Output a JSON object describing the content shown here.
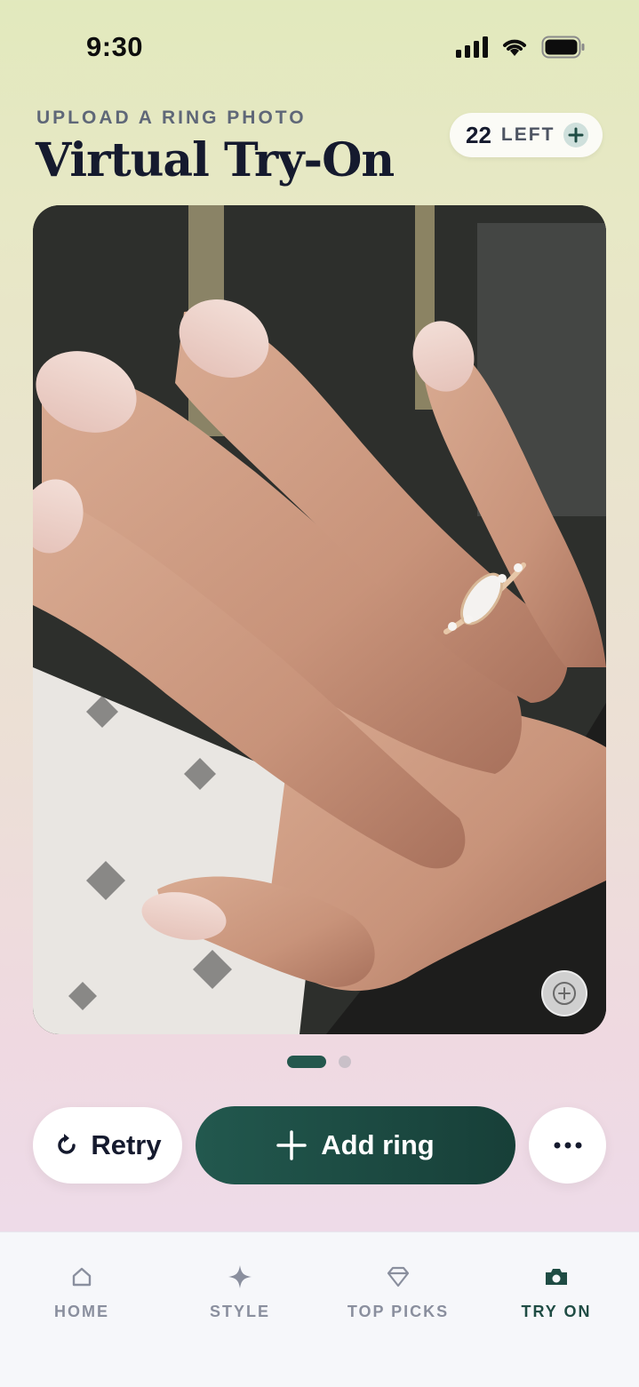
{
  "status_bar": {
    "time": "9:30"
  },
  "header": {
    "subtitle": "UPLOAD A RING PHOTO",
    "title": "Virtual Try-On",
    "credits": {
      "count": "22",
      "label": "LEFT"
    }
  },
  "photo": {
    "description_icon": "zoom-in-icon"
  },
  "pagination": {
    "total": 2,
    "active": 1
  },
  "actions": {
    "retry_label": "Retry",
    "add_ring_label": "Add ring"
  },
  "tab_bar": {
    "tabs": [
      {
        "label": "HOME",
        "icon": "home-icon",
        "active": false
      },
      {
        "label": "STYLE",
        "icon": "sparkle-icon",
        "active": false
      },
      {
        "label": "TOP PICKS",
        "icon": "diamond-icon",
        "active": false
      },
      {
        "label": "TRY ON",
        "icon": "camera-icon",
        "active": true
      }
    ]
  },
  "colors": {
    "accent": "#22584e",
    "text": "#151a2e",
    "muted": "#8a8f9e"
  }
}
